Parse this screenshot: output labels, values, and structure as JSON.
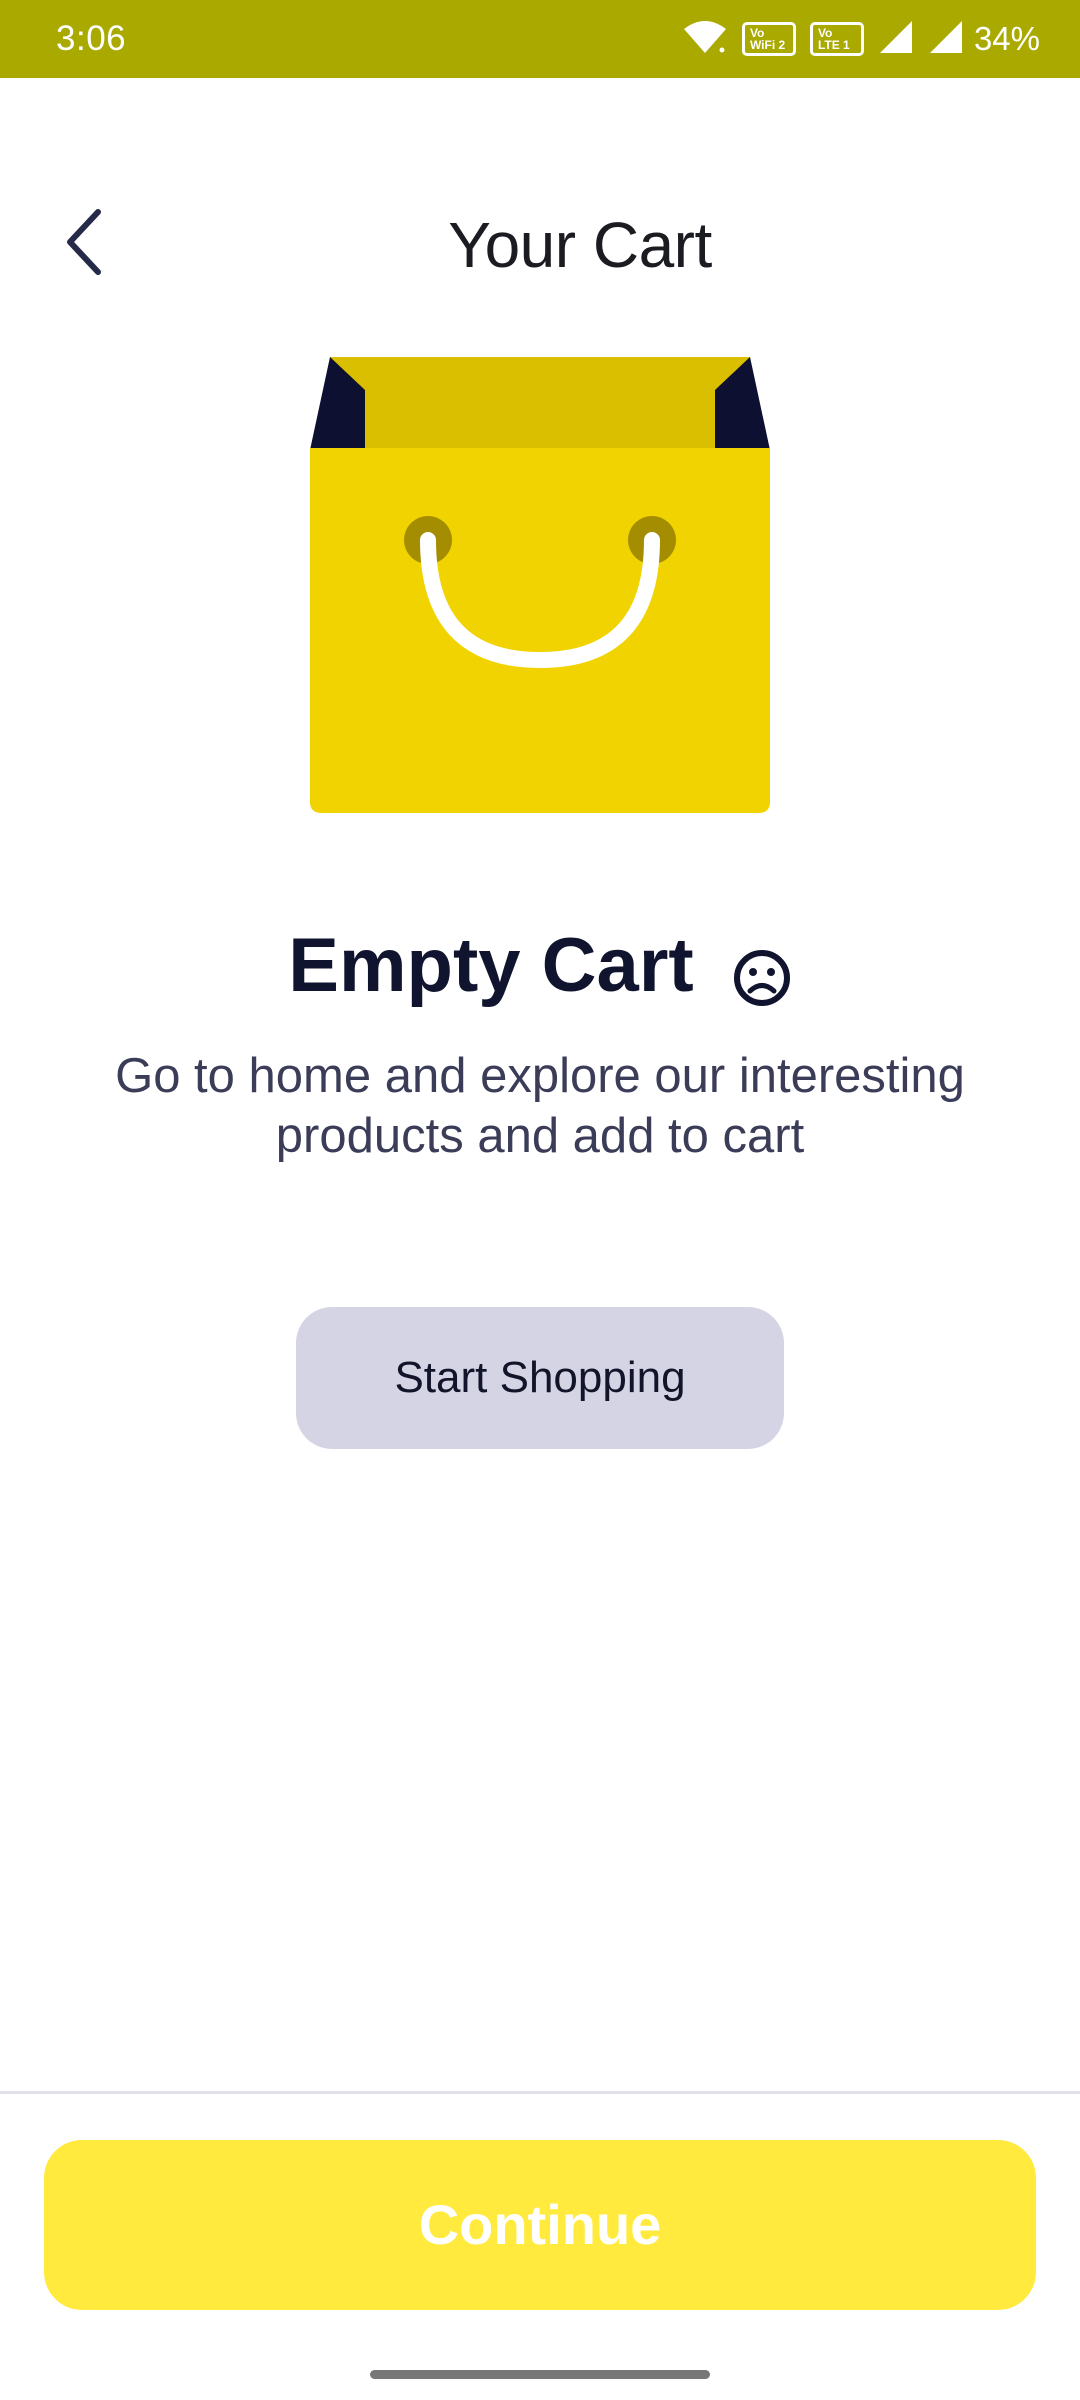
{
  "status_bar": {
    "time": "3:06",
    "battery": "34%",
    "badge_1": "Vo\nWiFi 2",
    "badge_2": "Vo\nLTE 1",
    "icons": [
      "wifi-icon",
      "vowifi-badge-icon",
      "volte-badge-icon",
      "cell-signal-icon",
      "cell-signal-icon",
      "battery-text"
    ],
    "background": "#a9a900"
  },
  "header": {
    "title": "Your Cart",
    "back_icon": "chevron-left-icon"
  },
  "illustration": {
    "icon": "shopping-bag-icon",
    "colors": {
      "bag": "#f0d300",
      "bag_top": "#d9bf00",
      "fold": "#0d1030"
    }
  },
  "empty_state": {
    "heading": "Empty Cart",
    "heading_icon": "sad-face-icon",
    "description": "Go to home and explore our interesting products and add to cart"
  },
  "actions": {
    "start_shopping_label": "Start Shopping",
    "continue_label": "Continue"
  },
  "colors": {
    "continue_button": "#ffea3d",
    "start_button": "#d4d4e4",
    "heading_text": "#10142e"
  }
}
